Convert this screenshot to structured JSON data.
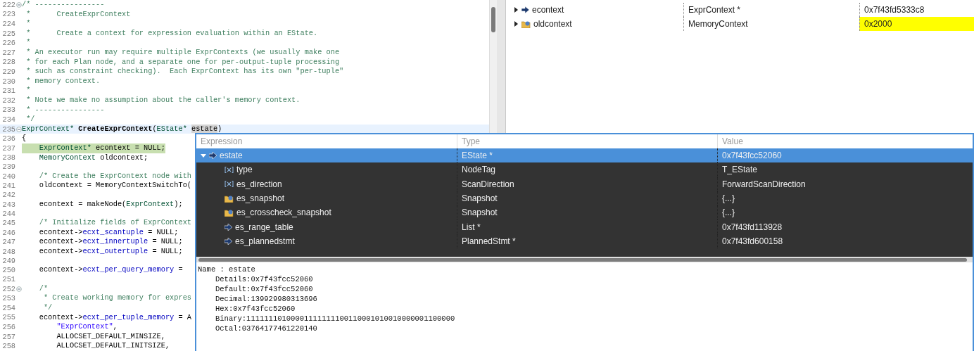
{
  "editor": {
    "lines": [
      {
        "number": "222",
        "fold": true,
        "tokens": [
          {
            "kind": "comment",
            "text": "/* ----------------"
          }
        ]
      },
      {
        "number": "223",
        "tokens": [
          {
            "kind": "comment",
            "text": " *      CreateExprContext"
          }
        ]
      },
      {
        "number": "224",
        "tokens": [
          {
            "kind": "comment",
            "text": " *"
          }
        ]
      },
      {
        "number": "225",
        "tokens": [
          {
            "kind": "comment",
            "text": " *      Create a context for expression evaluation within an EState."
          }
        ]
      },
      {
        "number": "226",
        "tokens": [
          {
            "kind": "comment",
            "text": " *"
          }
        ]
      },
      {
        "number": "227",
        "tokens": [
          {
            "kind": "comment",
            "text": " * An executor run may require multiple ExprContexts (we usually make one"
          }
        ]
      },
      {
        "number": "228",
        "tokens": [
          {
            "kind": "comment",
            "text": " * for each Plan node, and a separate one for per-output-tuple processing"
          }
        ]
      },
      {
        "number": "229",
        "tokens": [
          {
            "kind": "comment",
            "text": " * such as constraint checking).  Each ExprContext has its own \"per-tuple\""
          }
        ]
      },
      {
        "number": "230",
        "tokens": [
          {
            "kind": "comment",
            "text": " * memory context."
          }
        ]
      },
      {
        "number": "231",
        "tokens": [
          {
            "kind": "comment",
            "text": " *"
          }
        ]
      },
      {
        "number": "232",
        "tokens": [
          {
            "kind": "comment",
            "text": " * Note we make no assumption about the caller's memory context."
          }
        ]
      },
      {
        "number": "233",
        "tokens": [
          {
            "kind": "comment",
            "text": " * ----------------"
          }
        ]
      },
      {
        "number": "234",
        "tokens": [
          {
            "kind": "comment",
            "text": " */"
          }
        ]
      },
      {
        "number": "235",
        "fold": true,
        "hover": true,
        "tokens": [
          {
            "kind": "type",
            "text": "ExprContext* "
          },
          {
            "kind": "function",
            "text": "CreateExprContext"
          },
          {
            "kind": "plain",
            "text": "("
          },
          {
            "kind": "type",
            "text": "EState* "
          },
          {
            "kind": "occurrence",
            "text": "estate"
          },
          {
            "kind": "plain",
            "text": ")"
          }
        ]
      },
      {
        "number": "236",
        "tokens": [
          {
            "kind": "plain",
            "text": "{"
          }
        ]
      },
      {
        "number": "237",
        "current": true,
        "tokens": [
          {
            "kind": "type",
            "text": "    ExprContext*"
          },
          {
            "kind": "plain",
            "text": " econtext = NULL;"
          }
        ]
      },
      {
        "number": "238",
        "tokens": [
          {
            "kind": "type",
            "text": "    MemoryContext"
          },
          {
            "kind": "plain",
            "text": " oldcontext;"
          }
        ]
      },
      {
        "number": "239"
      },
      {
        "number": "240",
        "tokens": [
          {
            "kind": "comment",
            "text": "    /* Create the ExprContext node with"
          }
        ]
      },
      {
        "number": "241",
        "tokens": [
          {
            "kind": "plain",
            "text": "    oldcontext = MemoryContextSwitchTo("
          }
        ]
      },
      {
        "number": "242"
      },
      {
        "number": "243",
        "tokens": [
          {
            "kind": "plain",
            "text": "    econtext = makeNode("
          },
          {
            "kind": "type",
            "text": "ExprContext"
          },
          {
            "kind": "plain",
            "text": ");"
          }
        ]
      },
      {
        "number": "244"
      },
      {
        "number": "245",
        "tokens": [
          {
            "kind": "comment",
            "text": "    /* Initialize fields of ExprContext"
          }
        ]
      },
      {
        "number": "246",
        "tokens": [
          {
            "kind": "plain",
            "text": "    econtext->"
          },
          {
            "kind": "field",
            "text": "ecxt_scantuple"
          },
          {
            "kind": "plain",
            "text": " = NULL;"
          }
        ]
      },
      {
        "number": "247",
        "tokens": [
          {
            "kind": "plain",
            "text": "    econtext->"
          },
          {
            "kind": "field",
            "text": "ecxt_innertuple"
          },
          {
            "kind": "plain",
            "text": " = NULL;"
          }
        ]
      },
      {
        "number": "248",
        "tokens": [
          {
            "kind": "plain",
            "text": "    econtext->"
          },
          {
            "kind": "field",
            "text": "ecxt_outertuple"
          },
          {
            "kind": "plain",
            "text": " = NULL;"
          }
        ]
      },
      {
        "number": "249"
      },
      {
        "number": "250",
        "tokens": [
          {
            "kind": "plain",
            "text": "    econtext->"
          },
          {
            "kind": "field",
            "text": "ecxt_per_query_memory"
          },
          {
            "kind": "plain",
            "text": " ="
          }
        ]
      },
      {
        "number": "251"
      },
      {
        "number": "252",
        "fold": true,
        "tokens": [
          {
            "kind": "comment",
            "text": "    /*"
          }
        ]
      },
      {
        "number": "253",
        "tokens": [
          {
            "kind": "comment",
            "text": "     * Create working memory for expres"
          }
        ]
      },
      {
        "number": "254",
        "tokens": [
          {
            "kind": "comment",
            "text": "     */"
          }
        ]
      },
      {
        "number": "255",
        "tokens": [
          {
            "kind": "plain",
            "text": "    econtext->"
          },
          {
            "kind": "field",
            "text": "ecxt_per_tuple_memory"
          },
          {
            "kind": "plain",
            "text": " = A"
          }
        ]
      },
      {
        "number": "256",
        "tokens": [
          {
            "kind": "string",
            "text": "        \"ExprContext\""
          },
          {
            "kind": "plain",
            "text": ","
          }
        ]
      },
      {
        "number": "257",
        "tokens": [
          {
            "kind": "plain",
            "text": "        ALLOCSET_DEFAULT_MINSIZE,"
          }
        ]
      },
      {
        "number": "258",
        "tokens": [
          {
            "kind": "plain",
            "text": "        ALLOCSET_DEFAULT_INITSIZE,"
          }
        ]
      }
    ]
  },
  "variables": {
    "rows": [
      {
        "kind": "pointer",
        "name": "econtext",
        "type": "ExprContext *",
        "value": "0x7f43fd5333c8",
        "expanded": false,
        "changed": false
      },
      {
        "kind": "struct",
        "name": "oldcontext",
        "type": "MemoryContext",
        "value": "0x2000",
        "expanded": false,
        "changed": true
      }
    ]
  },
  "hover_popup": {
    "columns": [
      "Expression",
      "Type",
      "Value"
    ],
    "rows": [
      {
        "kind": "pointer",
        "name": "estate",
        "type": "EState *",
        "value": "0x7f43fcc52060",
        "expanded": true,
        "selected": true,
        "children": [
          {
            "kind": "enum",
            "name": "type",
            "type": "NodeTag",
            "value": "T_EState",
            "selected": false
          },
          {
            "kind": "enum",
            "name": "es_direction",
            "type": "ScanDirection",
            "value": "ForwardScanDirection",
            "selected": false
          },
          {
            "kind": "struct",
            "name": "es_snapshot",
            "type": "Snapshot",
            "value": "{...}",
            "selected": false
          },
          {
            "kind": "struct",
            "name": "es_crosscheck_snapshot",
            "type": "Snapshot",
            "value": "{...}",
            "selected": false
          },
          {
            "kind": "pointer",
            "name": "es_range_table",
            "type": "List *",
            "value": "0x7f43fd113928",
            "selected": false
          },
          {
            "kind": "pointer",
            "name": "es_plannedstmt",
            "type": "PlannedStmt *",
            "value": "0x7f43fd600158",
            "selected": false
          }
        ]
      }
    ],
    "details": {
      "heading": "Name : estate",
      "lines": [
        "Details:0x7f43fcc52060",
        "Default:0x7f43fcc52060",
        "Decimal:139929980313696",
        "Hex:0x7f43fcc52060",
        "Binary:11111110100001111111100110001010010000001100000",
        "Octal:03764177461220140"
      ]
    }
  }
}
